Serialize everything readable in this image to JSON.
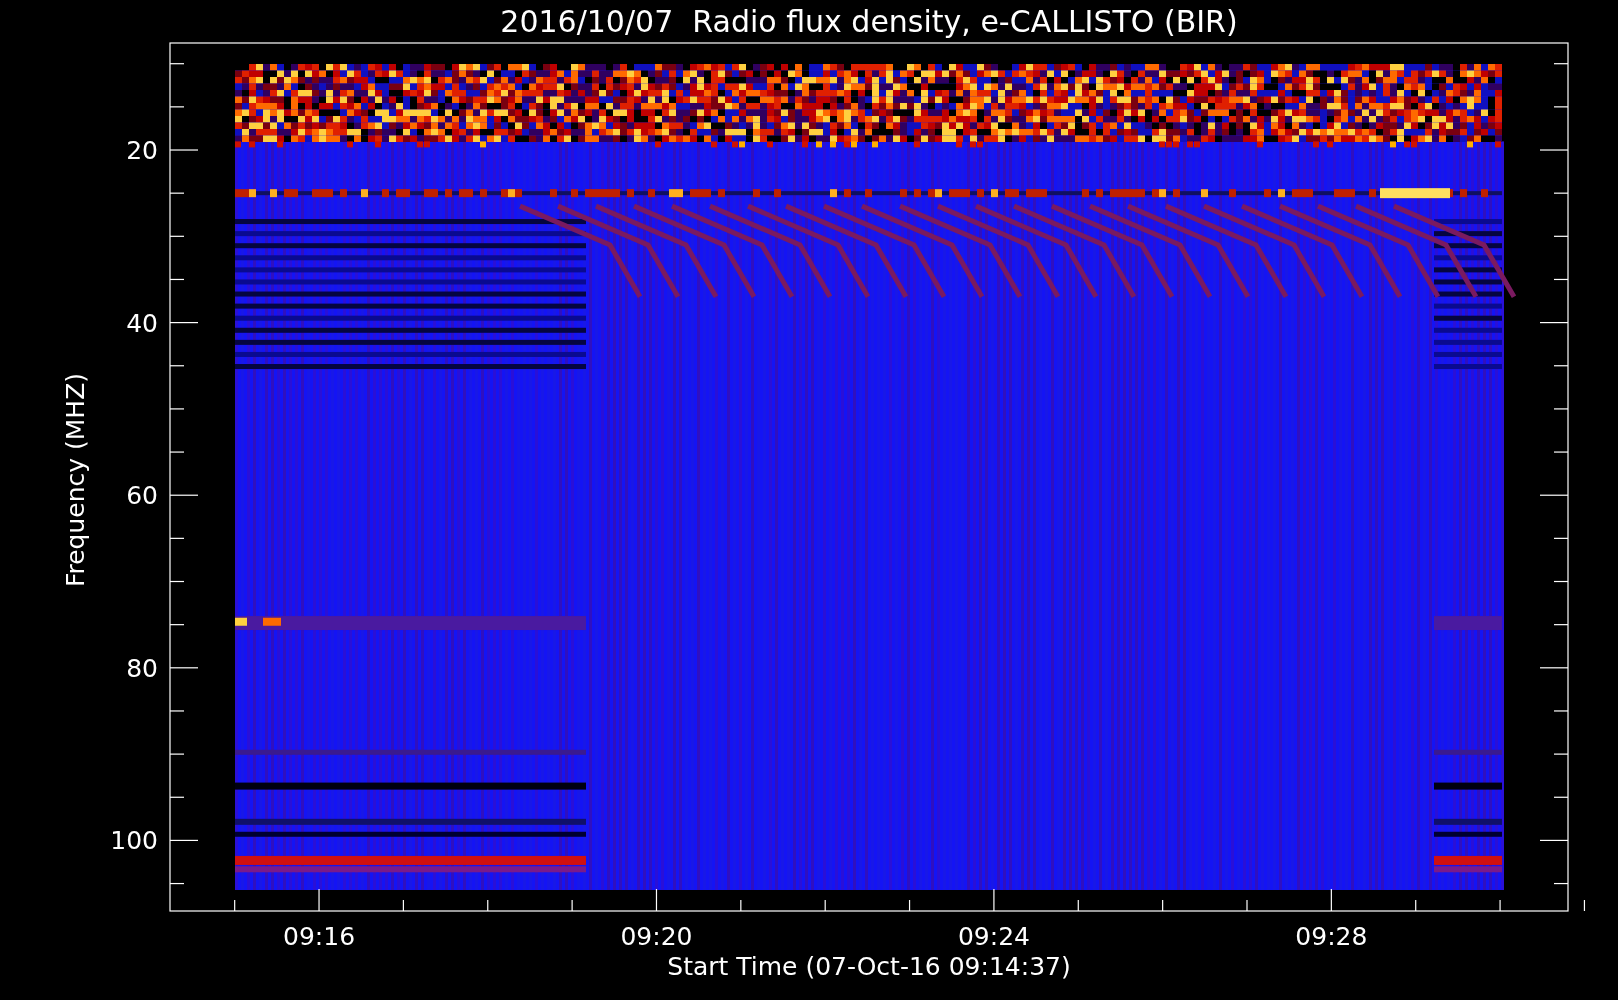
{
  "plot": {
    "title": "2016/10/07  Radio flux density, e-CALLISTO (BIR)",
    "ylabel": "Frequency (MHZ)",
    "xlabel": "Start Time (07-Oct-16 09:14:37)",
    "yticks": [
      "20",
      "40",
      "60",
      "80",
      "100"
    ],
    "xticks": [
      "09:16",
      "09:20",
      "09:24",
      "09:28"
    ]
  }
}
